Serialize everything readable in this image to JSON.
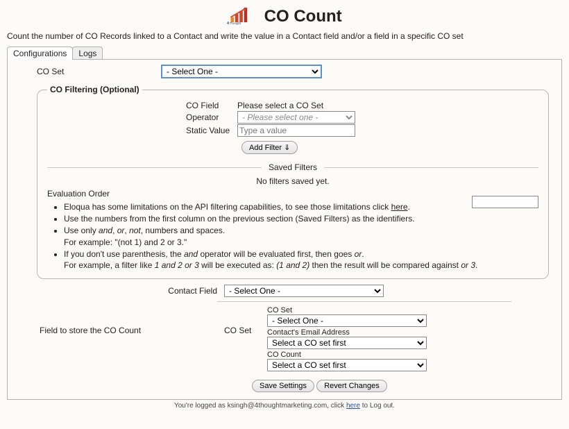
{
  "header": {
    "title": "CO Count",
    "subtitle": "Count the number of CO Records linked to a Contact and write the value in a Contact field and/or a field in a specific CO set"
  },
  "tabs": {
    "configurations": "Configurations",
    "logs": "Logs"
  },
  "coset": {
    "label": "CO Set",
    "selected": "- Select One -"
  },
  "filtering": {
    "legend": "CO Filtering (Optional)",
    "co_field_label": "CO Field",
    "co_field_hint": "Please select a CO Set",
    "operator_label": "Operator",
    "operator_selected": "- Please select one -",
    "static_label": "Static Value",
    "static_placeholder": "Type a value",
    "add_filter_label": "Add Filter ⇓",
    "saved_filters_label": "Saved Filters",
    "no_filters_text": "No filters saved yet.",
    "eval_order_label": "Evaluation Order",
    "notes": {
      "n1a": "Eloqua has some limitations on the API filtering capabilities, to see those limitations click ",
      "n1link": "here",
      "n1b": ".",
      "n2": "Use the numbers from the first column on the previous section (Saved Filters) as the identifiers.",
      "n3a": "Use only ",
      "n3and": "and",
      "n3sep1": ", ",
      "n3or": "or",
      "n3sep2": ", ",
      "n3not": "not",
      "n3b": ", numbers and spaces.",
      "n3ex": "For example: \"(not 1) and 2 or 3.\"",
      "n4a": "If you don't use parenthesis, the ",
      "n4and": "and",
      "n4b": " operator will be evaluated first, then goes ",
      "n4or": "or",
      "n4c": ".",
      "n4d": "For example, a filter like ",
      "n4e": "1 and 2 or 3",
      "n4f": " will be executed as: ",
      "n4g": "(1 and 2)",
      "n4h": " then the result will be compared against ",
      "n4i": "or 3",
      "n4j": "."
    }
  },
  "bottom": {
    "contact_field_label": "Contact Field",
    "contact_field_selected": "- Select One -",
    "store_label": "Field to store the CO Count",
    "coset_col_label": "CO Set",
    "coset_sub_label": "CO Set",
    "coset_sub_selected": "- Select One -",
    "email_label": "Contact's Email Address",
    "email_selected": "Select a CO set first",
    "count_label": "CO Count",
    "count_selected": "Select a CO set first",
    "save_label": "Save Settings",
    "revert_label": "Revert Changes"
  },
  "footer": {
    "a": "You're logged as ksingh@4thoughtmarketing.com, click ",
    "link": "here",
    "b": " to Log out."
  }
}
